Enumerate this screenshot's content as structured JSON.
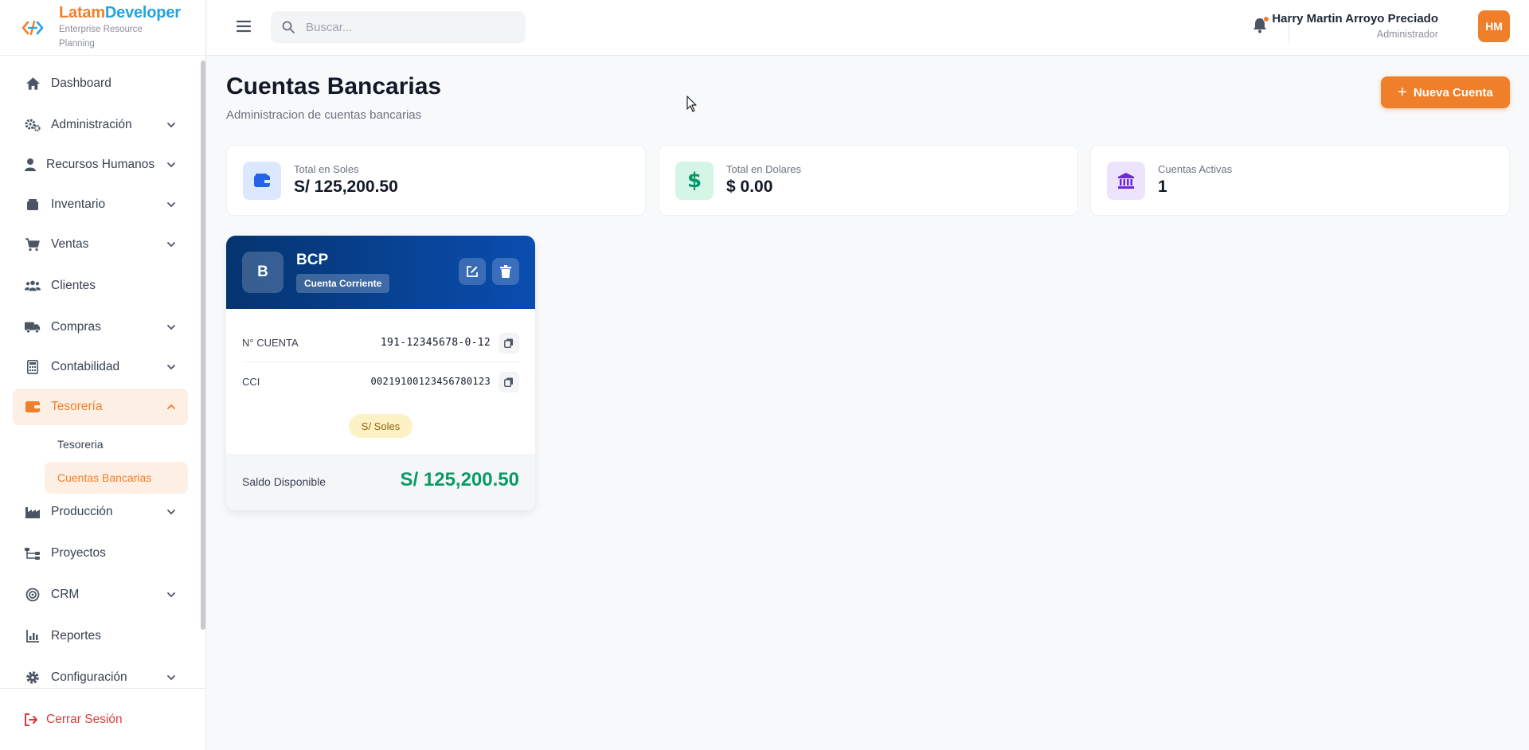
{
  "brand": {
    "name_a": "Latam",
    "name_b": "Developer",
    "subtitle": "Enterprise Resource Planning"
  },
  "sidebar": {
    "items": [
      {
        "label": "Dashboard",
        "icon": "home-icon",
        "expandable": false
      },
      {
        "label": "Administración",
        "icon": "gears-icon",
        "expandable": true
      },
      {
        "label": "Recursos Humanos",
        "icon": "user-icon",
        "expandable": true
      },
      {
        "label": "Inventario",
        "icon": "box-icon",
        "expandable": true
      },
      {
        "label": "Ventas",
        "icon": "cart-icon",
        "expandable": true
      },
      {
        "label": "Clientes",
        "icon": "users-icon",
        "expandable": false
      },
      {
        "label": "Compras",
        "icon": "truck-icon",
        "expandable": true
      },
      {
        "label": "Contabilidad",
        "icon": "calculator-icon",
        "expandable": true
      },
      {
        "label": "Tesorería",
        "icon": "wallet-icon",
        "expandable": true,
        "active": true
      },
      {
        "label": "Producción",
        "icon": "factory-icon",
        "expandable": true
      },
      {
        "label": "Proyectos",
        "icon": "sitemap-icon",
        "expandable": false
      },
      {
        "label": "CRM",
        "icon": "target-icon",
        "expandable": true
      },
      {
        "label": "Reportes",
        "icon": "chart-icon",
        "expandable": false
      },
      {
        "label": "Configuración",
        "icon": "gear-icon",
        "expandable": true
      }
    ],
    "sub_items": [
      {
        "label": "Tesoreria"
      },
      {
        "label": "Cuentas Bancarias",
        "active": true
      }
    ],
    "logout": "Cerrar Sesión"
  },
  "topbar": {
    "search_placeholder": "Buscar...",
    "user_name": "Harry Martin Arroyo Preciado",
    "user_role": "Administrador",
    "avatar_initials": "HM"
  },
  "page": {
    "title": "Cuentas Bancarias",
    "subtitle": "Administracion de cuentas bancarias",
    "new_button": "Nueva Cuenta"
  },
  "stats": [
    {
      "label": "Total en Soles",
      "value": "S/ 125,200.50",
      "icon": "wallet-icon"
    },
    {
      "label": "Total en Dolares",
      "value": "$ 0.00",
      "icon": "dollar-icon"
    },
    {
      "label": "Cuentas Activas",
      "value": "1",
      "icon": "bank-icon"
    }
  ],
  "account": {
    "initial": "B",
    "bank": "BCP",
    "type": "Cuenta Corriente",
    "number_label": "N° CUENTA",
    "number": "191-12345678-0-12",
    "cci_label": "CCI",
    "cci": "00219100123456780123",
    "currency": "S/ Soles",
    "balance_label": "Saldo Disponible",
    "balance": "S/ 125,200.50"
  },
  "colors": {
    "accent": "#f07f2a",
    "brand_blue": "#20a4e6",
    "card_header": "#0a4db0",
    "balance_green": "#0a9a63",
    "danger": "#dc3a3a"
  }
}
